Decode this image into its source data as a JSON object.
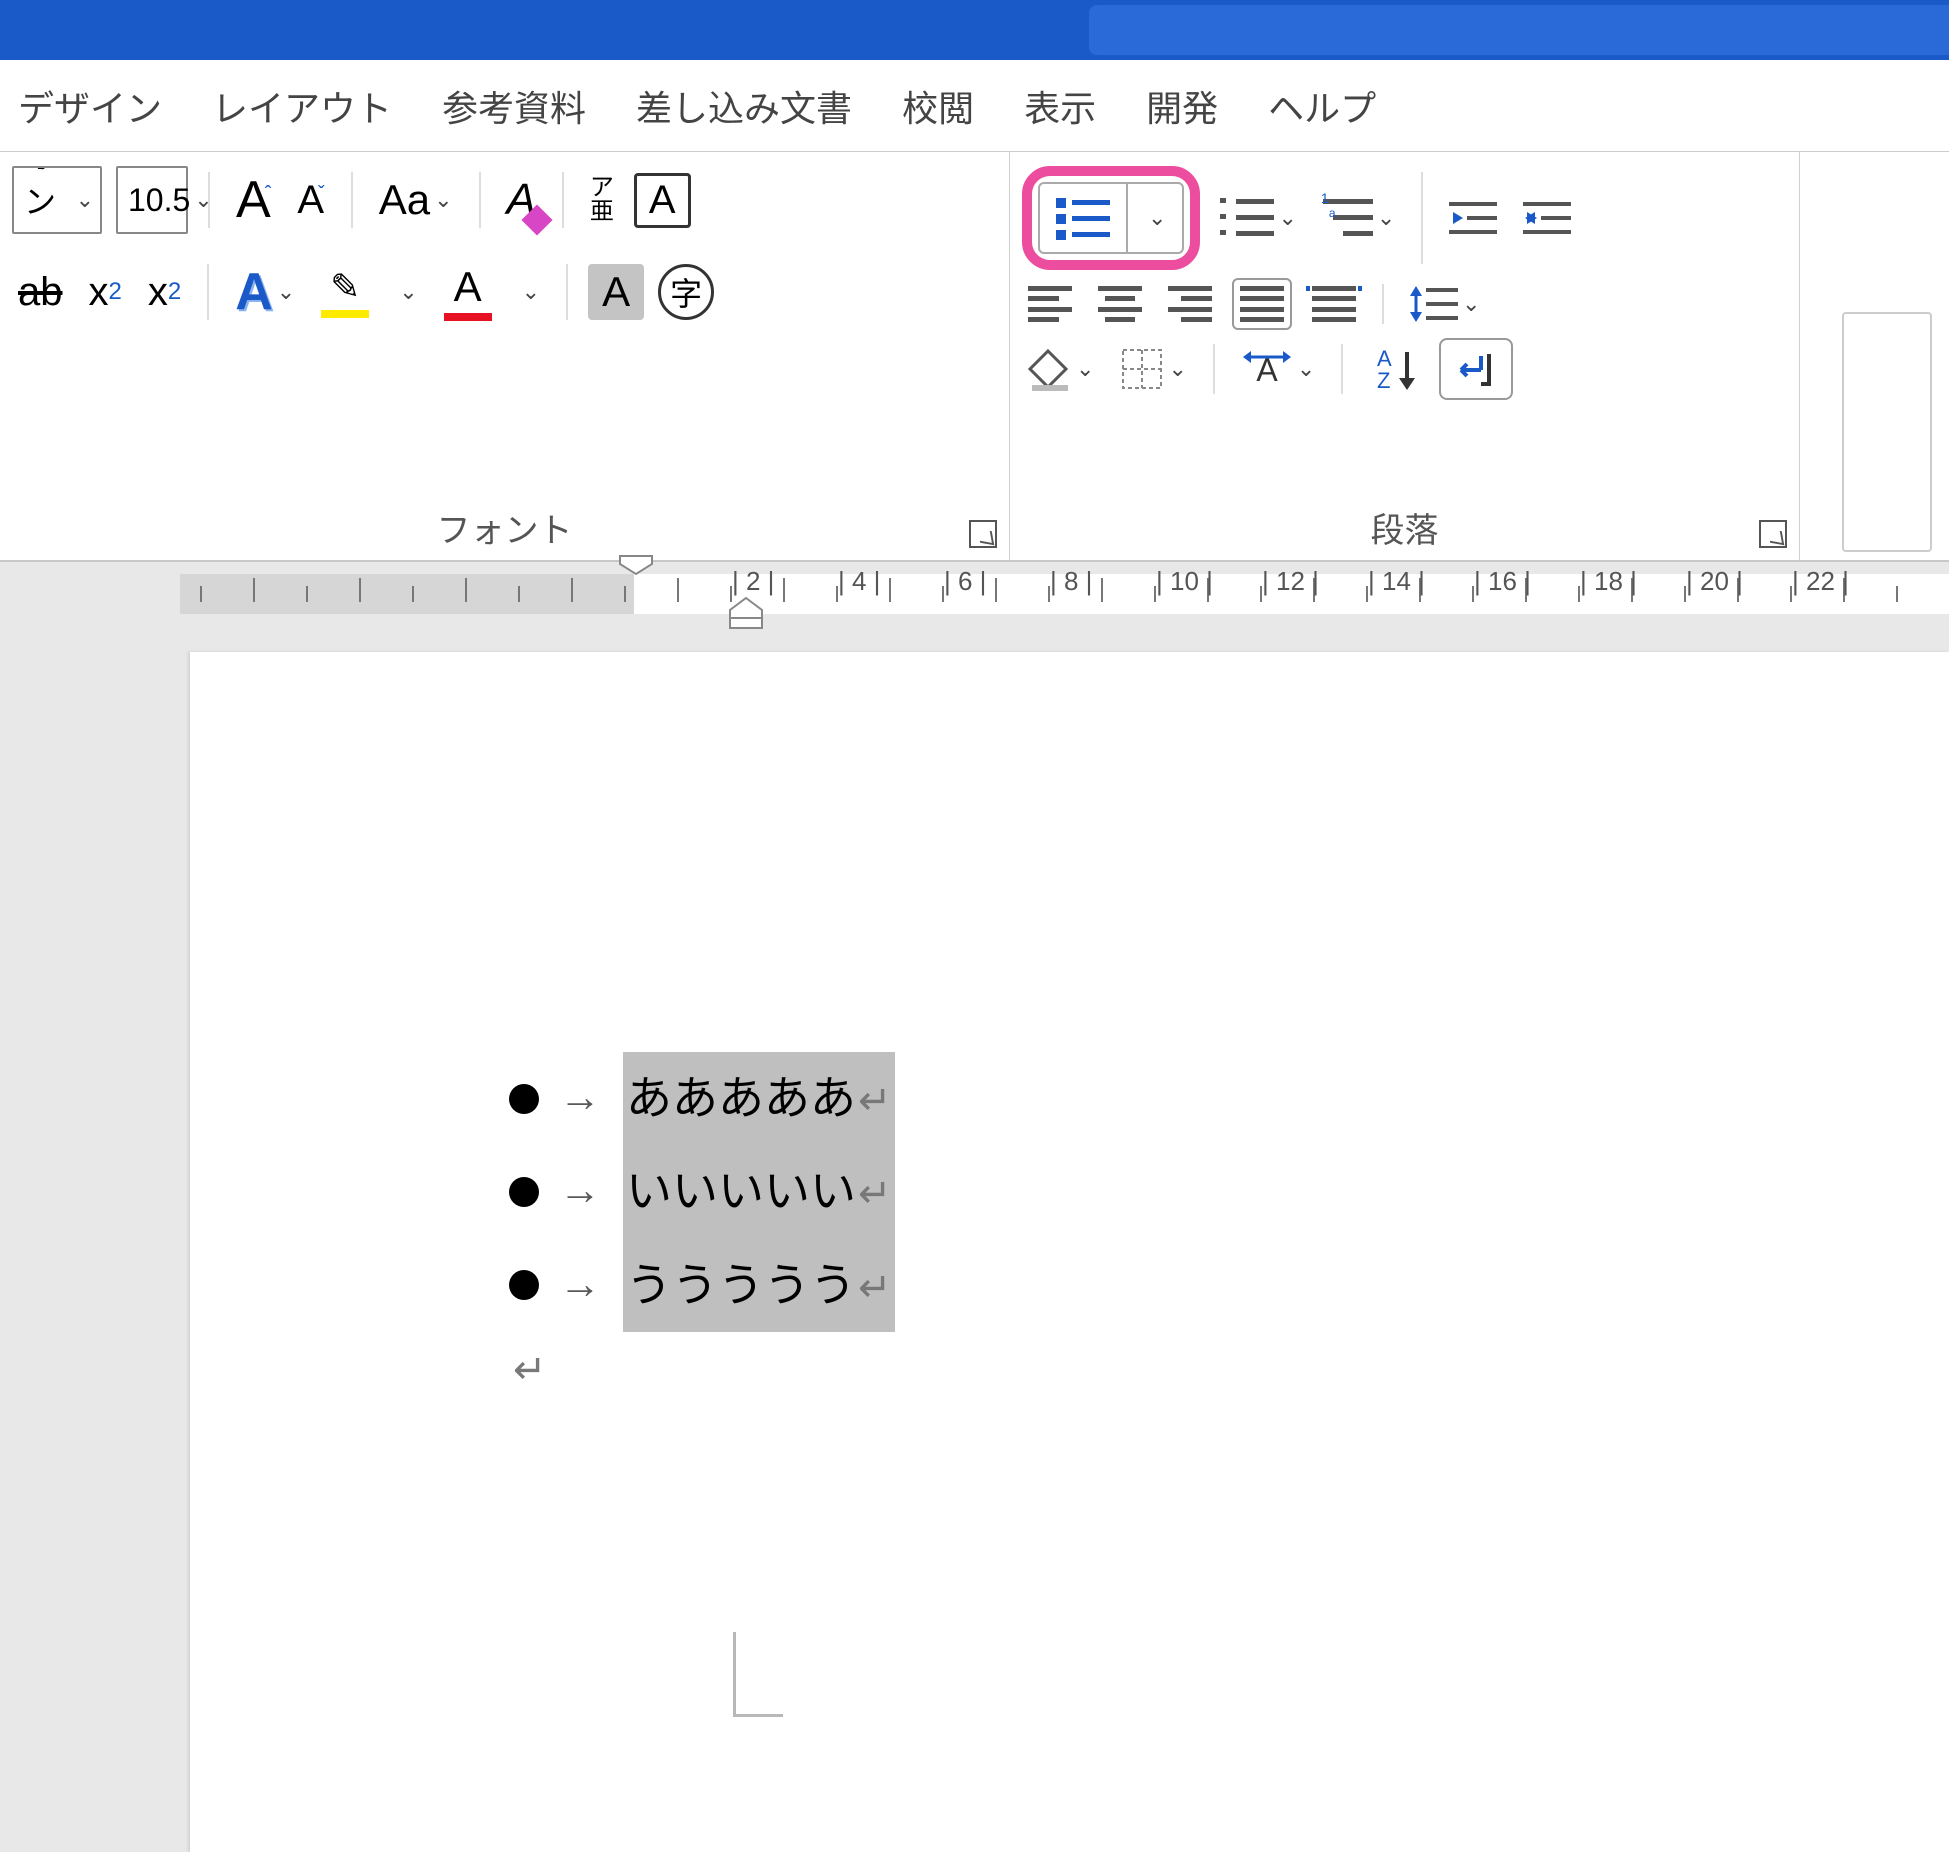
{
  "menu": {
    "tabs": [
      "デザイン",
      "レイアウト",
      "参考資料",
      "差し込み文書",
      "校閲",
      "表示",
      "開発",
      "ヘルプ"
    ]
  },
  "font_group": {
    "label": "フォント",
    "font_name": "ォント",
    "font_size": "10.5",
    "grow": "A",
    "shrink": "A",
    "case": "Aa",
    "clear": "A",
    "phonetic": "ア\n亜",
    "charborder": "A",
    "strike": "ab",
    "sub": "x",
    "sub_n": "2",
    "sup": "x",
    "sup_n": "2",
    "texteffect": "A",
    "highlight": "",
    "fontcolor": "A",
    "shading": "A",
    "enclose": "字"
  },
  "para_group": {
    "label": "段落"
  },
  "ruler": {
    "labels": [
      "2",
      "4",
      "6",
      "8",
      "10",
      "12",
      "14",
      "16",
      "18",
      "20",
      "22"
    ]
  },
  "doc": {
    "lines": [
      "あああああ",
      "いいいいい",
      "ううううう"
    ]
  }
}
